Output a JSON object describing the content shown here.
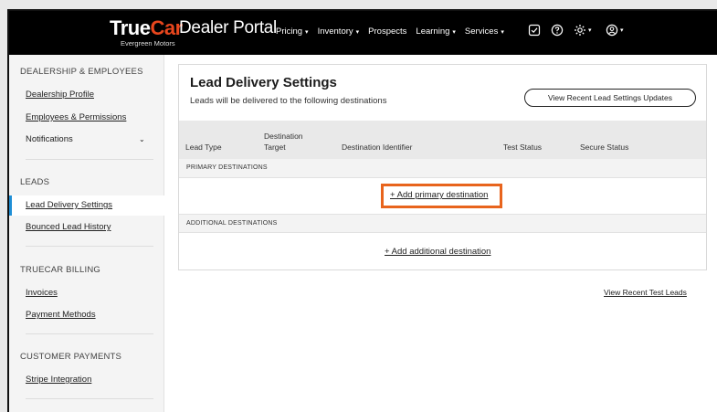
{
  "header": {
    "brand_true": "True",
    "brand_car": "Car",
    "brand_sub": "Evergreen Motors",
    "portal": "Dealer Portal",
    "nav": [
      {
        "label": "Pricing"
      },
      {
        "label": "Inventory"
      },
      {
        "label": "Prospects"
      },
      {
        "label": "Learning"
      },
      {
        "label": "Services"
      }
    ]
  },
  "sidebar": {
    "sections": [
      {
        "title": "DEALERSHIP & EMPLOYEES"
      },
      {
        "title": "LEADS"
      },
      {
        "title": "TRUECAR BILLING"
      },
      {
        "title": "CUSTOMER PAYMENTS"
      }
    ],
    "links": {
      "dealership_profile": "Dealership Profile",
      "employees_permissions": "Employees & Permissions",
      "notifications": "Notifications",
      "lead_delivery_settings": "Lead Delivery Settings",
      "bounced_lead_history": "Bounced Lead History",
      "invoices": "Invoices",
      "payment_methods": "Payment Methods",
      "stripe_integration": "Stripe Integration"
    }
  },
  "main": {
    "title": "Lead Delivery Settings",
    "subtitle": "Leads will be delivered to the following destinations",
    "view_updates_button": "View Recent Lead Settings Updates",
    "columns": {
      "lead_type": "Lead Type",
      "destination_target_1": "Destination",
      "destination_target_2": "Target",
      "destination_identifier": "Destination Identifier",
      "test_status": "Test Status",
      "secure_status": "Secure Status"
    },
    "primary_label": "PRIMARY DESTINATIONS",
    "add_primary": "+ Add primary destination",
    "additional_label": "ADDITIONAL DESTINATIONS",
    "add_additional": "+ Add additional destination",
    "view_test_leads": "View Recent Test Leads"
  },
  "colors": {
    "brand_accent": "#e8461d",
    "highlight": "#e8641d",
    "active_indicator": "#1f8fd6"
  }
}
